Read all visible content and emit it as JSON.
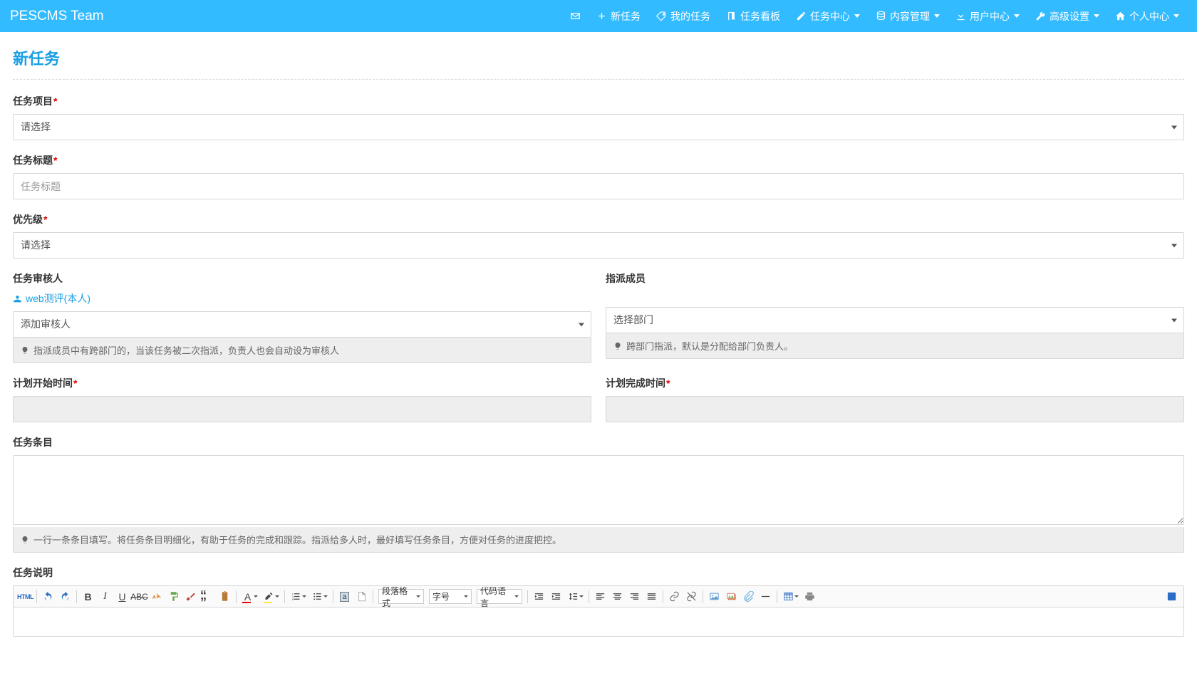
{
  "brand": "PESCMS Team",
  "nav": {
    "new_task": "新任务",
    "my_tasks": "我的任务",
    "task_board": "任务看板",
    "task_center": "任务中心",
    "content_mgmt": "内容管理",
    "user_center": "用户中心",
    "adv_settings": "高级设置",
    "personal_center": "个人中心"
  },
  "page": {
    "title": "新任务"
  },
  "labels": {
    "project": "任务项目",
    "title": "任务标题",
    "priority": "优先级",
    "reviewer": "任务审核人",
    "assign": "指派成员",
    "plan_start": "计划开始时间",
    "plan_end": "计划完成时间",
    "items": "任务条目",
    "desc": "任务说明"
  },
  "placeholders": {
    "select": "请选择",
    "title": "任务标题",
    "add_reviewer": "添加审核人",
    "select_dept": "选择部门"
  },
  "reviewer_link": "web测评(本人)",
  "hints": {
    "reviewer": "指派成员中有跨部门的，当该任务被二次指派，负责人也会自动设为审核人",
    "assign": "跨部门指派，默认是分配给部门负责人。",
    "items": "一行一条条目填写。将任务条目明细化，有助于任务的完成和跟踪。指派给多人时，最好填写任务条目，方便对任务的进度把控。"
  },
  "editor": {
    "para_format": "段落格式",
    "font_size": "字号",
    "code_lang": "代码语言"
  }
}
